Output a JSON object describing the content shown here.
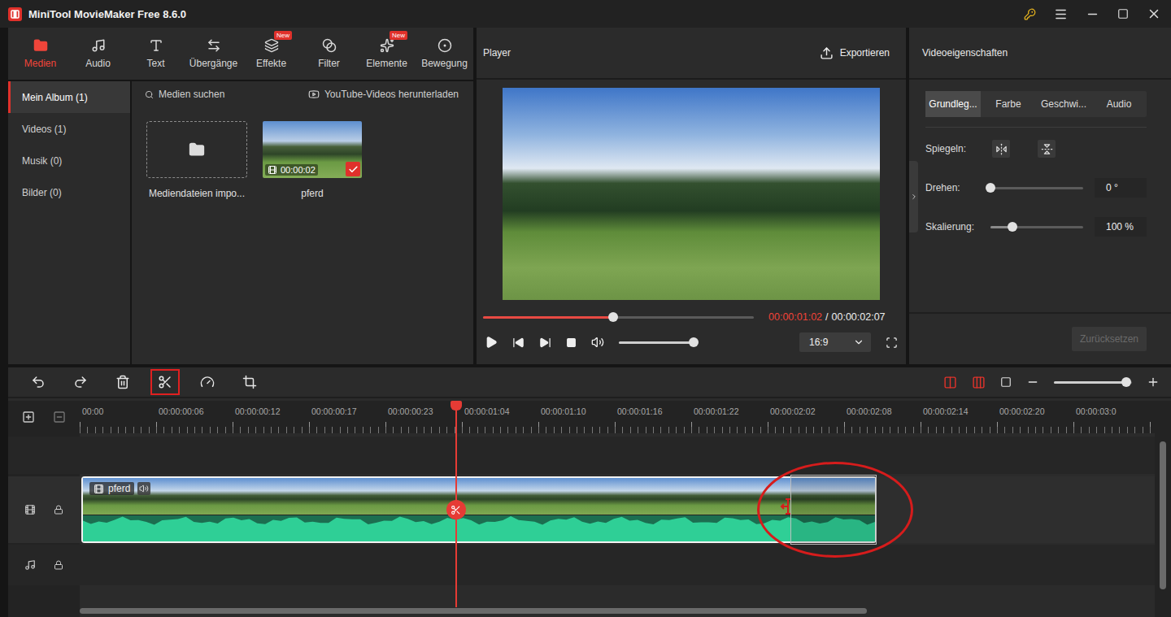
{
  "window": {
    "title": "MiniTool MovieMaker Free 8.6.0"
  },
  "tabs": [
    {
      "label": "Medien",
      "selected": true
    },
    {
      "label": "Audio",
      "selected": false
    },
    {
      "label": "Text",
      "selected": false
    },
    {
      "label": "Übergänge",
      "selected": false
    },
    {
      "label": "Effekte",
      "selected": false,
      "badge": "New"
    },
    {
      "label": "Filter",
      "selected": false
    },
    {
      "label": "Elemente",
      "selected": false,
      "badge": "New"
    },
    {
      "label": "Bewegung",
      "selected": false
    }
  ],
  "sidebar": {
    "items": [
      {
        "label": "Mein Album (1)",
        "selected": true
      },
      {
        "label": "Videos (1)",
        "selected": false
      },
      {
        "label": "Musik (0)",
        "selected": false
      },
      {
        "label": "Bilder (0)",
        "selected": false
      }
    ]
  },
  "media": {
    "search": "Medien suchen",
    "download": "YouTube-Videos herunterladen",
    "import_label": "Mediendateien impo...",
    "clips": [
      {
        "name": "pferd",
        "duration": "00:00:02",
        "checked": true
      }
    ]
  },
  "player": {
    "title": "Player",
    "export": "Exportieren",
    "current": "00:00:01:02",
    "separator": "/",
    "total": "00:00:02:07",
    "progress": 0.48,
    "volume": 1.0,
    "aspect": "16:9"
  },
  "properties": {
    "title": "Videoeigenschaften",
    "tabs": [
      {
        "label": "Grundleg...",
        "selected": true
      },
      {
        "label": "Farbe",
        "selected": false
      },
      {
        "label": "Geschwi...",
        "selected": false
      },
      {
        "label": "Audio",
        "selected": false
      }
    ],
    "rows": [
      {
        "label": "Spiegeln:",
        "kind": "mirror"
      },
      {
        "label": "Drehen:",
        "kind": "slider",
        "level": 0,
        "value": "0 °"
      },
      {
        "label": "Skalierung:",
        "kind": "slider",
        "level": 0.24,
        "value": "100 %"
      }
    ],
    "reset": {
      "label": "Zurücksetzen",
      "disabled": true
    }
  },
  "timeline": {
    "tools": [
      {
        "highlighted": false
      },
      {
        "highlighted": false
      },
      {
        "highlighted": false
      },
      {
        "highlighted": true
      },
      {
        "highlighted": false
      },
      {
        "highlighted": false
      }
    ],
    "zoom": 0.93,
    "ruler": [
      "00:00",
      "00:00:00:06",
      "00:00:00:12",
      "00:00:00:17",
      "00:00:00:23",
      "00:00:01:04",
      "00:00:01:10",
      "00:00:01:16",
      "00:00:01:22",
      "00:00:02:02",
      "00:00:02:08",
      "00:00:02:14",
      "00:00:02:20",
      "00:00:03:0"
    ],
    "playhead": 0.35,
    "clip": {
      "name": "pferd",
      "end": 0.74,
      "trim_highlighted": true
    }
  }
}
